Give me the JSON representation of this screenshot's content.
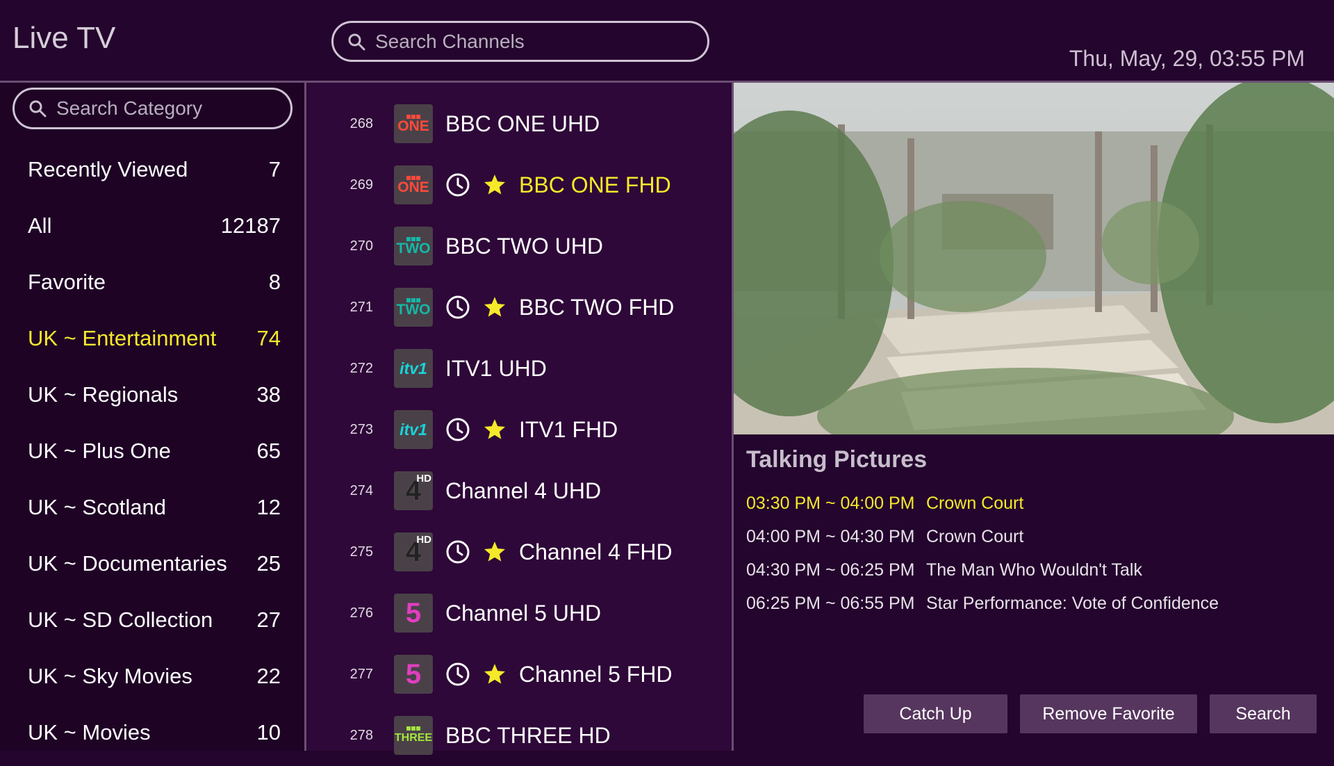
{
  "header": {
    "title": "Live TV",
    "search_placeholder": "Search Channels",
    "datetime": "Thu, May, 29, 03:55 PM"
  },
  "sidebar": {
    "search_placeholder": "Search Category",
    "categories": [
      {
        "label": "Recently Viewed",
        "count": "7"
      },
      {
        "label": "All",
        "count": "12187"
      },
      {
        "label": "Favorite",
        "count": "8"
      },
      {
        "label": "UK ~ Entertainment",
        "count": "74",
        "active": true
      },
      {
        "label": "UK ~ Regionals",
        "count": "38"
      },
      {
        "label": "UK ~ Plus One",
        "count": "65"
      },
      {
        "label": "UK ~ Scotland",
        "count": "12"
      },
      {
        "label": "UK ~ Documentaries",
        "count": "25"
      },
      {
        "label": "UK ~ SD Collection",
        "count": "27"
      },
      {
        "label": "UK ~ Sky Movies",
        "count": "22"
      },
      {
        "label": "UK ~ Movies",
        "count": "10"
      }
    ]
  },
  "channels": [
    {
      "number": "268",
      "name": "BBC ONE UHD",
      "logo_text": "ONE",
      "icons": []
    },
    {
      "number": "269",
      "name": "BBC ONE FHD",
      "logo_text": "ONE",
      "icons": [
        "clock-icon",
        "star-icon"
      ],
      "active": true
    },
    {
      "number": "270",
      "name": "BBC TWO UHD",
      "logo_text": "TWO",
      "icons": []
    },
    {
      "number": "271",
      "name": "BBC TWO FHD",
      "logo_text": "TWO",
      "icons": [
        "clock-icon",
        "star-icon"
      ]
    },
    {
      "number": "272",
      "name": "ITV1 UHD",
      "logo_text": "itv1",
      "icons": []
    },
    {
      "number": "273",
      "name": "ITV1 FHD",
      "logo_text": "itv1",
      "icons": [
        "clock-icon",
        "star-icon"
      ]
    },
    {
      "number": "274",
      "name": "Channel 4 UHD",
      "logo_text": "4",
      "logo_badge": "HD",
      "icons": []
    },
    {
      "number": "275",
      "name": "Channel 4 FHD",
      "logo_text": "4",
      "logo_badge": "HD",
      "icons": [
        "clock-icon",
        "star-icon"
      ]
    },
    {
      "number": "276",
      "name": "Channel 5 UHD",
      "logo_text": "5",
      "icons": []
    },
    {
      "number": "277",
      "name": "Channel 5 FHD",
      "logo_text": "5",
      "icons": [
        "clock-icon",
        "star-icon"
      ]
    },
    {
      "number": "278",
      "name": "BBC THREE HD",
      "logo_text": "THREE",
      "icons": []
    }
  ],
  "program": {
    "channel_title": "Talking Pictures",
    "schedule": [
      {
        "time": "03:30 PM ~ 04:00 PM",
        "title": "Crown Court",
        "current": true
      },
      {
        "time": "04:00 PM ~ 04:30 PM",
        "title": "Crown Court"
      },
      {
        "time": "04:30 PM ~ 06:25 PM",
        "title": "The Man Who Wouldn't Talk"
      },
      {
        "time": "06:25 PM ~ 06:55 PM",
        "title": "Star Performance: Vote of Confidence"
      }
    ]
  },
  "actions": {
    "catch_up": "Catch Up",
    "remove_favorite": "Remove Favorite",
    "search": "Search"
  },
  "colors": {
    "background": "#24052d",
    "highlight": "#f5e92a",
    "button": "#56365e",
    "divider": "#6b4e73"
  }
}
